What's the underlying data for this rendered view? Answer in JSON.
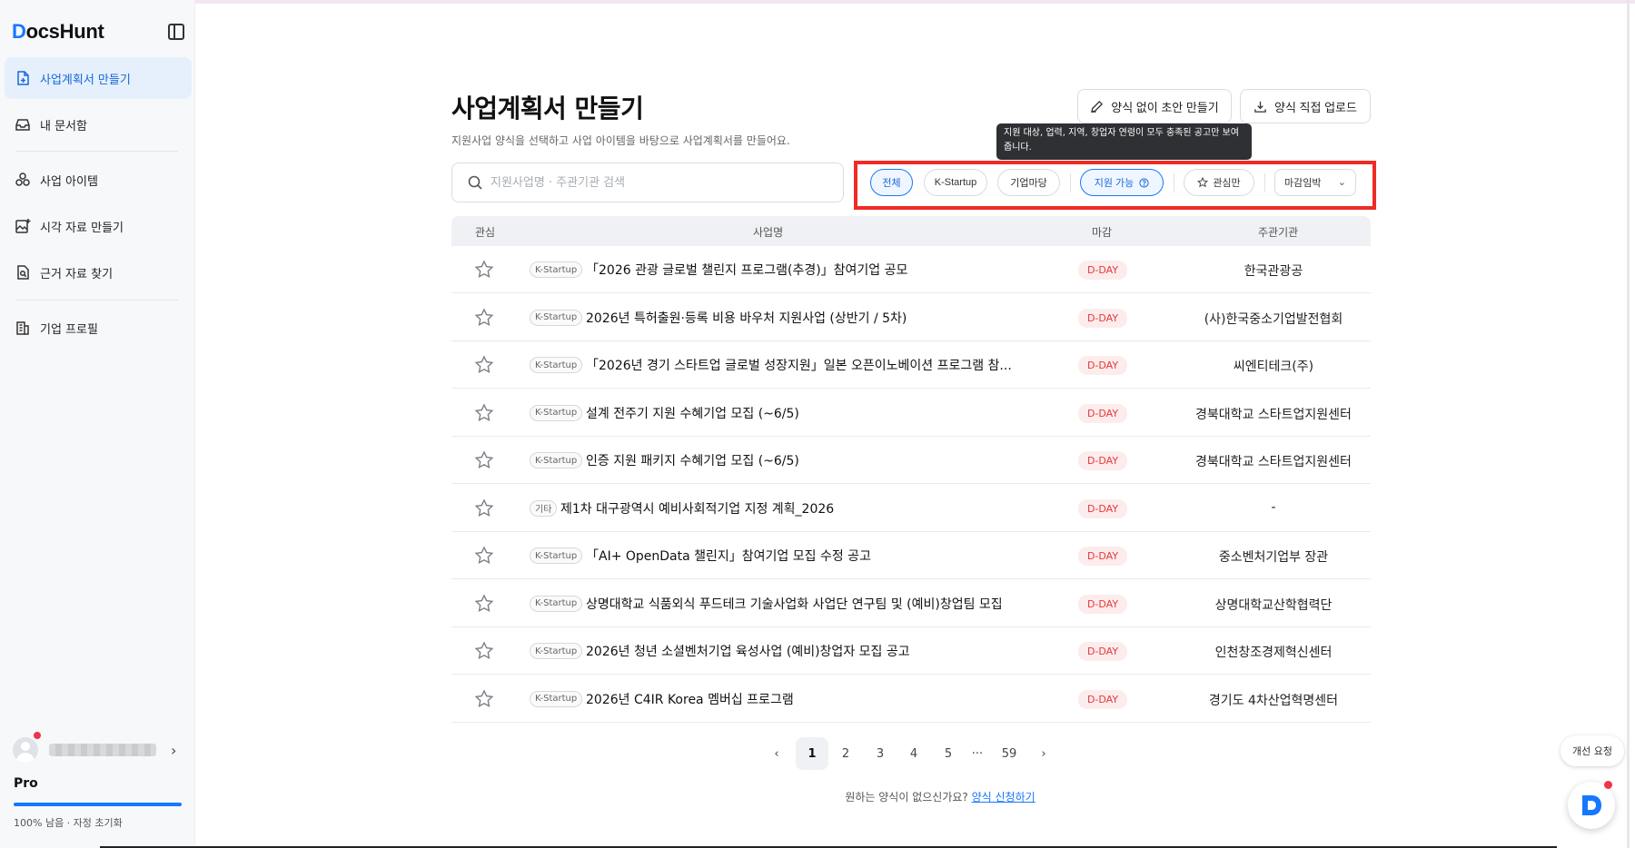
{
  "app": {
    "logo_d": "D",
    "logo_rest": "ocsHunt"
  },
  "sidebar": {
    "items": [
      {
        "label": "사업계획서 만들기",
        "icon": "document-plus-icon",
        "active": true
      },
      {
        "label": "내 문서함",
        "icon": "inbox-icon"
      },
      {
        "label": "사업 아이템",
        "icon": "shapes-icon"
      },
      {
        "label": "시각 자료 만들기",
        "icon": "image-plus-icon"
      },
      {
        "label": "근거 자료 찾기",
        "icon": "document-search-icon"
      },
      {
        "label": "기업 프로필",
        "icon": "building-icon"
      }
    ],
    "plan": {
      "name": "Pro",
      "status": "100% 남음 · 자정 초기화",
      "remaining_pct": 100
    }
  },
  "header": {
    "title": "사업계획서 만들기",
    "subtitle": "지원사업 양식을 선택하고 사업 아이템을 바탕으로 사업계획서를 만들어요.",
    "draft_button": "양식 없이 초안 만들기",
    "upload_button": "양식 직접 업로드"
  },
  "search": {
    "placeholder": "지원사업명 · 주관기관 검색",
    "value": ""
  },
  "filters": {
    "all": "전체",
    "kstartup": "K-Startup",
    "bizmadang": "기업마당",
    "eligible": "지원 가능",
    "favorites": "관심만",
    "sort": "마감임박",
    "tooltip": "지원 대상, 업력, 지역, 창업자 연령이 모두 충족된 공고만 보여줍니다."
  },
  "table": {
    "headers": {
      "favorite": "관심",
      "name": "사업명",
      "deadline": "마감",
      "org": "주관기관"
    },
    "rows": [
      {
        "tag": "K-Startup",
        "title": "「2026 관광 글로벌 챌린지 프로그램(추경)」참여기업 공모",
        "deadline": "D-DAY",
        "org": "한국관광공"
      },
      {
        "tag": "K-Startup",
        "title": "2026년 특허출원·등록 비용 바우처 지원사업 (상반기 / 5차)",
        "deadline": "D-DAY",
        "org": "(사)한국중소기업발전협회"
      },
      {
        "tag": "K-Startup",
        "title": "「2026년 경기 스타트업 글로벌 성장지원」일본 오픈이노베이션 프로그램 참...",
        "deadline": "D-DAY",
        "org": "씨엔티테크(주)"
      },
      {
        "tag": "K-Startup",
        "title": "설계 전주기 지원 수혜기업 모집 (~6/5)",
        "deadline": "D-DAY",
        "org": "경북대학교 스타트업지원센터"
      },
      {
        "tag": "K-Startup",
        "title": "인증 지원 패키지 수혜기업 모집 (~6/5)",
        "deadline": "D-DAY",
        "org": "경북대학교 스타트업지원센터"
      },
      {
        "tag": "기타",
        "title": "제1차 대구광역시 예비사회적기업 지정 계획_2026",
        "deadline": "D-DAY",
        "org": "-"
      },
      {
        "tag": "K-Startup",
        "title": "「AI+ OpenData 챌린지」참여기업 모집 수정 공고",
        "deadline": "D-DAY",
        "org": "중소벤처기업부 장관"
      },
      {
        "tag": "K-Startup",
        "title": "상명대학교 식품외식 푸드테크 기술사업화 사업단 연구팀 및 (예비)창업팀 모집",
        "deadline": "D-DAY",
        "org": "상명대학교산학협력단"
      },
      {
        "tag": "K-Startup",
        "title": "2026년 청년 소셜벤처기업 육성사업 (예비)창업자 모집 공고",
        "deadline": "D-DAY",
        "org": "인천창조경제혁신센터"
      },
      {
        "tag": "K-Startup",
        "title": "2026년 C4IR Korea 멤버십 프로그램",
        "deadline": "D-DAY",
        "org": "경기도 4차산업혁명센터"
      }
    ]
  },
  "pagination": {
    "pages": [
      "1",
      "2",
      "3",
      "4",
      "5"
    ],
    "ellipsis": "···",
    "last": "59",
    "current": "1",
    "prev": "‹",
    "next": "›"
  },
  "footer": {
    "question": "원하는 양식이 없으신가요?",
    "link": "양식 신청하기"
  },
  "floating": {
    "feedback": "개선 요청"
  },
  "colors": {
    "accent": "#1677ff",
    "danger": "#e5383b",
    "highlight_frame": "#ee2b24"
  }
}
